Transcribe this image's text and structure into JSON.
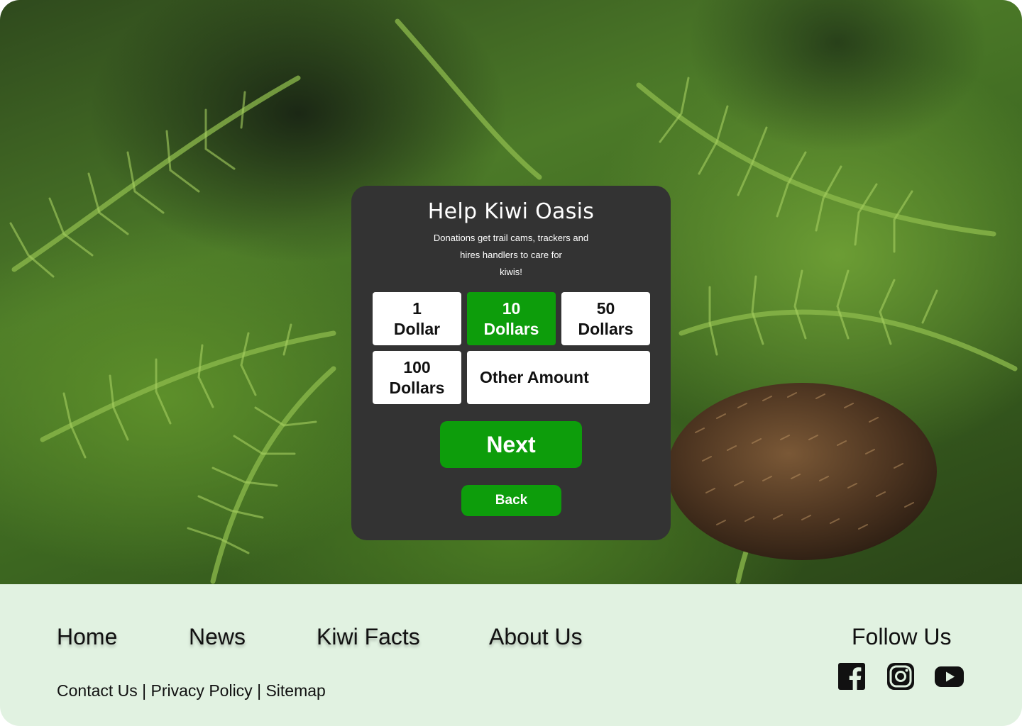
{
  "card": {
    "title": "Help Kiwi Oasis",
    "description_lines": [
      "Donations get trail cams, trackers and",
      "hires handlers to care for",
      "kiwis!"
    ],
    "amounts": [
      {
        "line1": "1",
        "line2": "Dollar",
        "selected": false
      },
      {
        "line1": "10",
        "line2": "Dollars",
        "selected": true
      },
      {
        "line1": "50",
        "line2": "Dollars",
        "selected": false
      },
      {
        "line1": "100",
        "line2": "Dollars",
        "selected": false
      }
    ],
    "other_amount": "Other Amount",
    "next_label": "Next",
    "back_label": "Back"
  },
  "footer": {
    "nav": [
      "Home",
      "News",
      "Kiwi Facts",
      "About Us"
    ],
    "legal": {
      "contact": "Contact Us",
      "separator": "|",
      "privacy": "Privacy Policy",
      "sitemap": "Sitemap"
    },
    "follow_title": "Follow Us",
    "social_icons": [
      "facebook-icon",
      "instagram-icon",
      "youtube-icon"
    ]
  },
  "colors": {
    "accent": "#0d9d0b",
    "card_bg": "#333333",
    "footer_bg": "#e1f2e1"
  }
}
